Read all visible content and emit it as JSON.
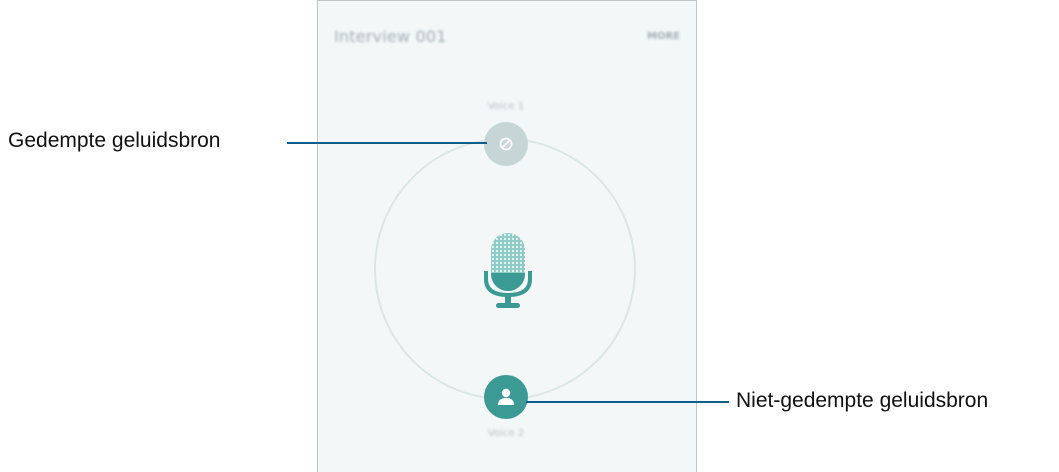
{
  "screen": {
    "title": "Interview 001",
    "more_label": "MORE"
  },
  "voices": [
    {
      "label": "Voice 1",
      "state": "muted",
      "icon": "muted-icon"
    },
    {
      "label": "Voice 2",
      "state": "unmuted",
      "icon": "person-icon"
    }
  ],
  "center_icon": "microphone-icon",
  "callouts": {
    "muted": "Gedempte geluidsbron",
    "unmuted": "Niet-gedempte geluidsbron"
  },
  "colors": {
    "accent": "#3c9a95",
    "muted_source": "#c6d6d6",
    "ring": "#dbe6e6",
    "leader_line": "#0b5f8a"
  }
}
